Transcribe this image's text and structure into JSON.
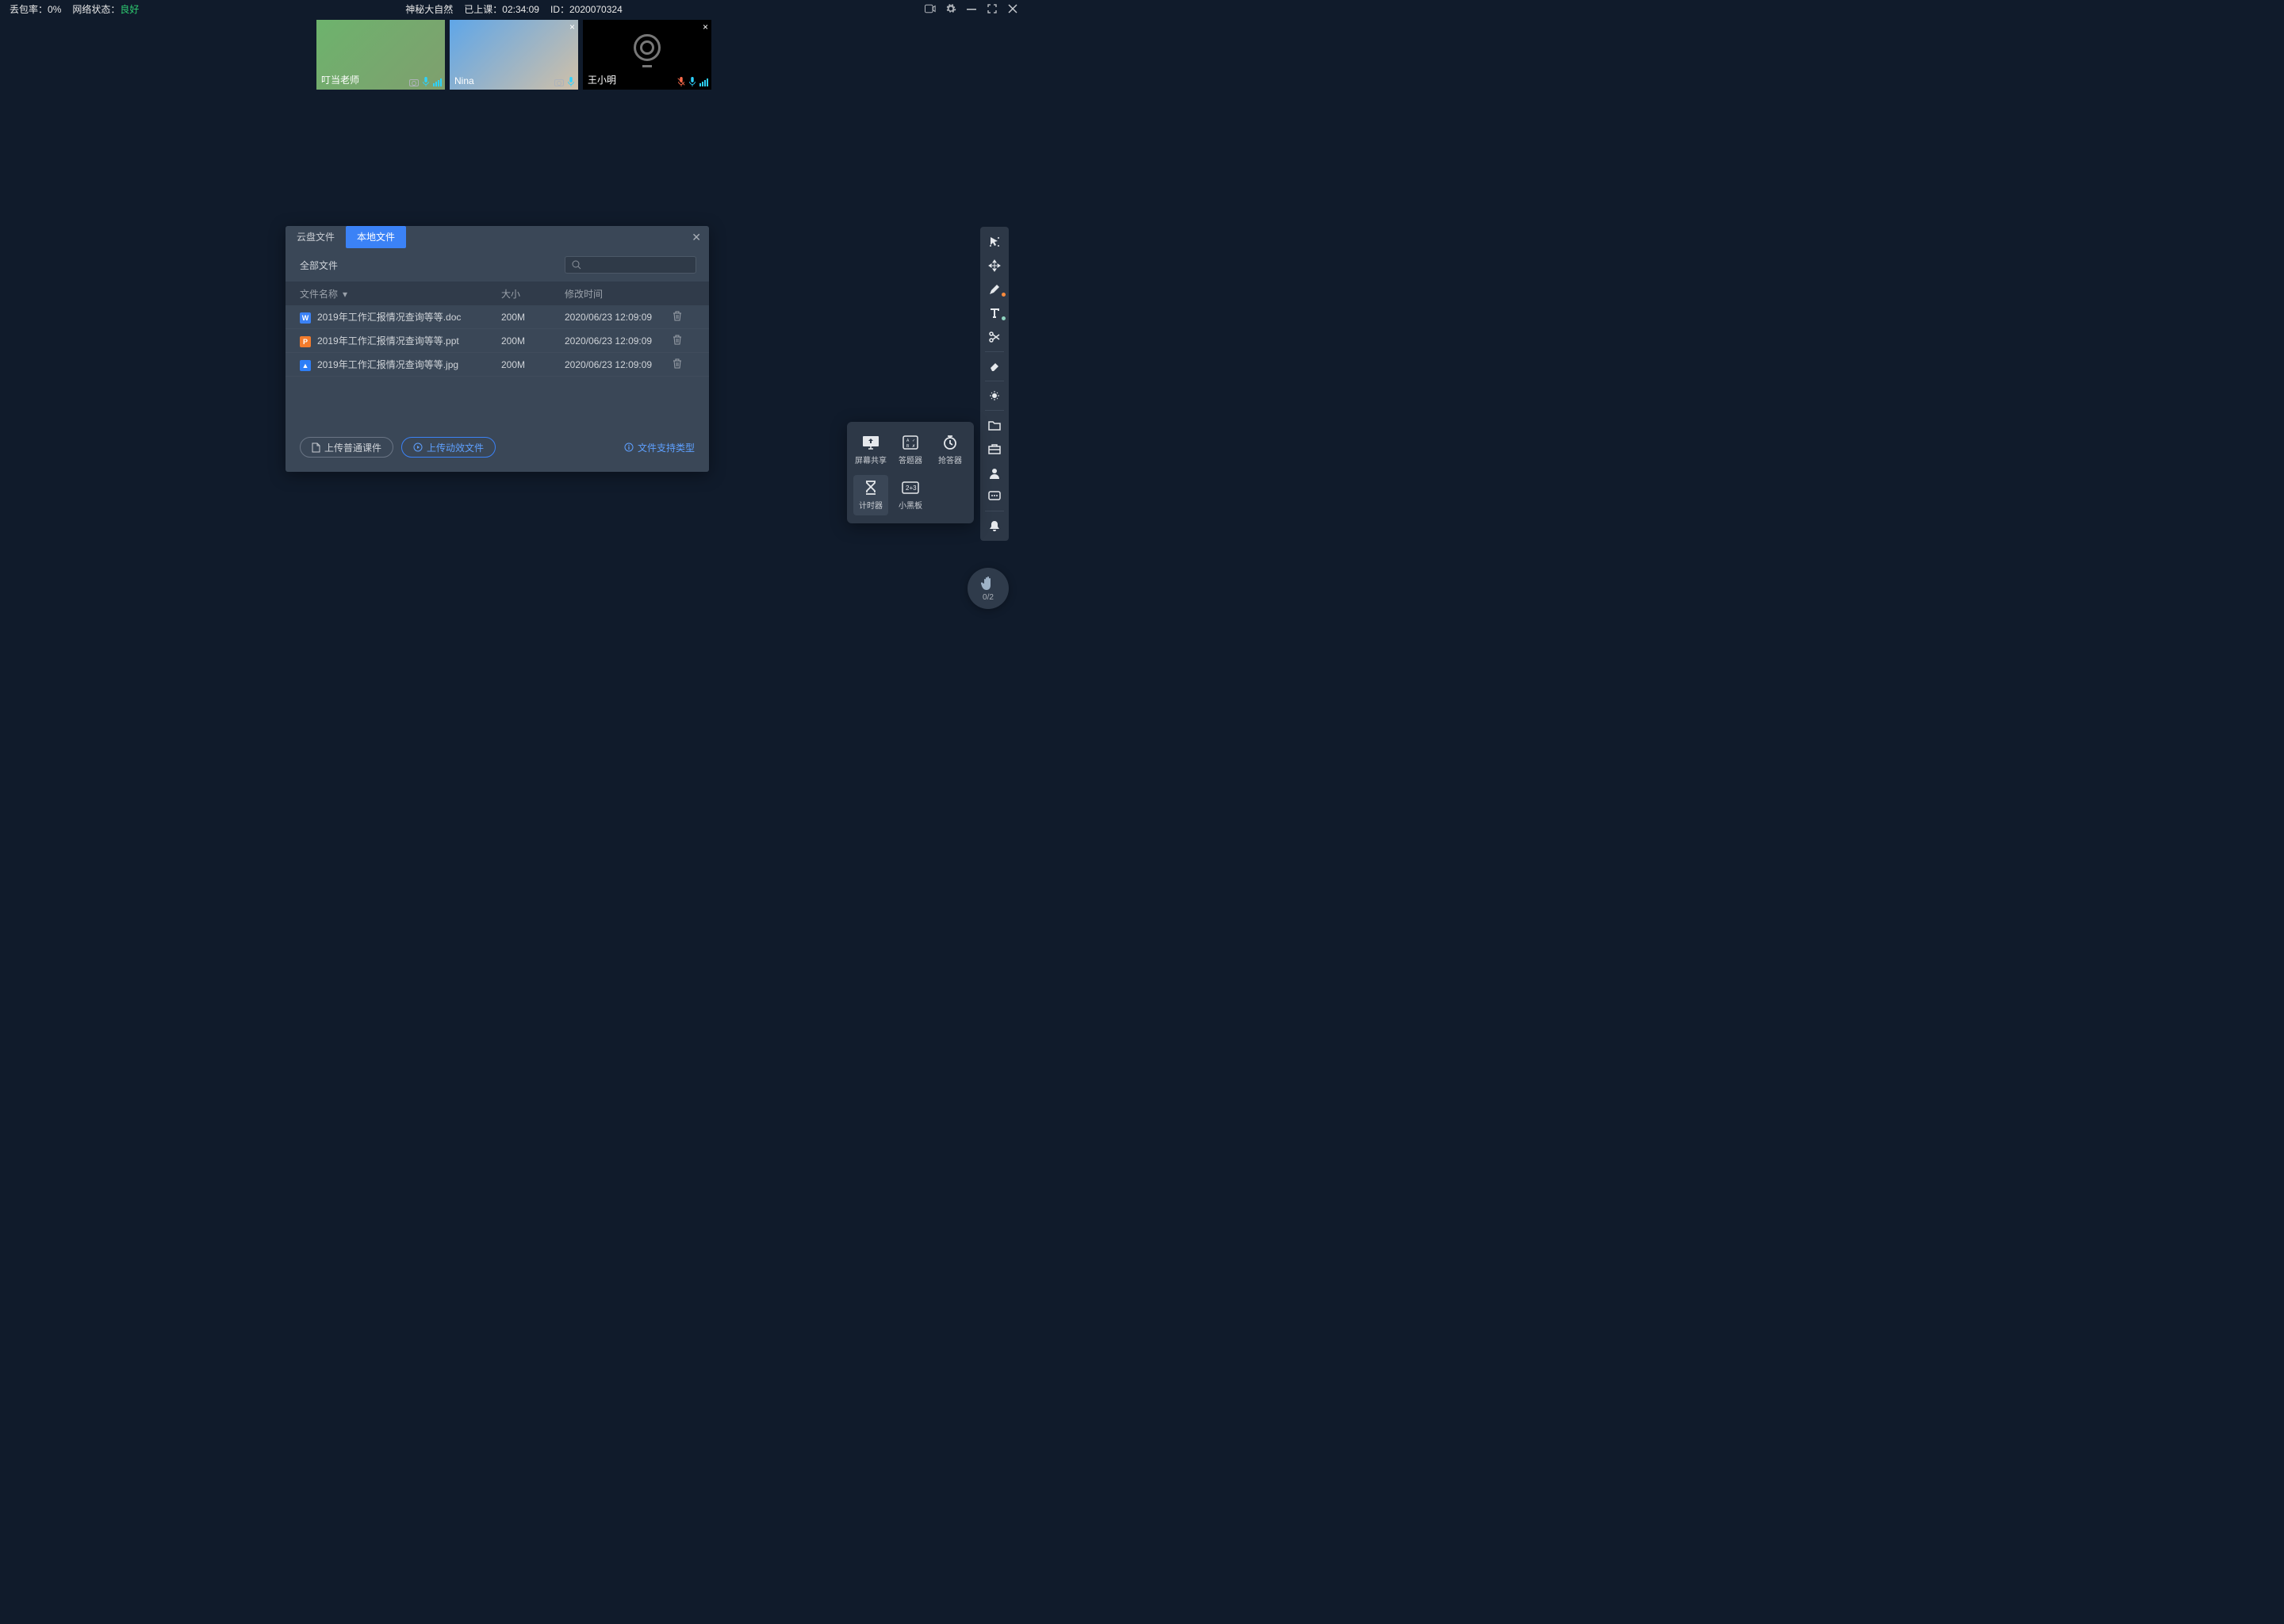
{
  "top": {
    "loss_label": "丢包率：",
    "loss_value": "0%",
    "net_label": "网络状态：",
    "net_value": "良好",
    "title": "神秘大自然",
    "elapsed_label": "已上课：",
    "elapsed_value": "02:34:09",
    "id_label": "ID：",
    "id_value": "2020070324"
  },
  "videos": [
    {
      "name": "叮当老师",
      "muted": false,
      "cam": true
    },
    {
      "name": "Nina",
      "muted": false,
      "cam": true
    },
    {
      "name": "王小明",
      "muted": true,
      "cam": false
    }
  ],
  "dialog": {
    "tab_cloud": "云盘文件",
    "tab_local": "本地文件",
    "all_files": "全部文件",
    "col_name": "文件名称",
    "col_size": "大小",
    "col_time": "修改时间",
    "files": [
      {
        "icon": "W",
        "name": "2019年工作汇报情况查询等等.doc",
        "size": "200M",
        "time": "2020/06/23 12:09:09"
      },
      {
        "icon": "P",
        "name": "2019年工作汇报情况查询等等.ppt",
        "size": "200M",
        "time": "2020/06/23 12:09:09"
      },
      {
        "icon": "IMG",
        "name": "2019年工作汇报情况查询等等.jpg",
        "size": "200M",
        "time": "2020/06/23 12:09:09"
      }
    ],
    "upload_normal": "上传普通课件",
    "upload_motion": "上传动效文件",
    "file_types": "文件支持类型"
  },
  "tools": {
    "screen_share": "屏幕共享",
    "answer": "答题器",
    "responder": "抢答器",
    "timer": "计时器",
    "blackboard": "小黑板"
  },
  "hand": {
    "count": "0/2"
  }
}
